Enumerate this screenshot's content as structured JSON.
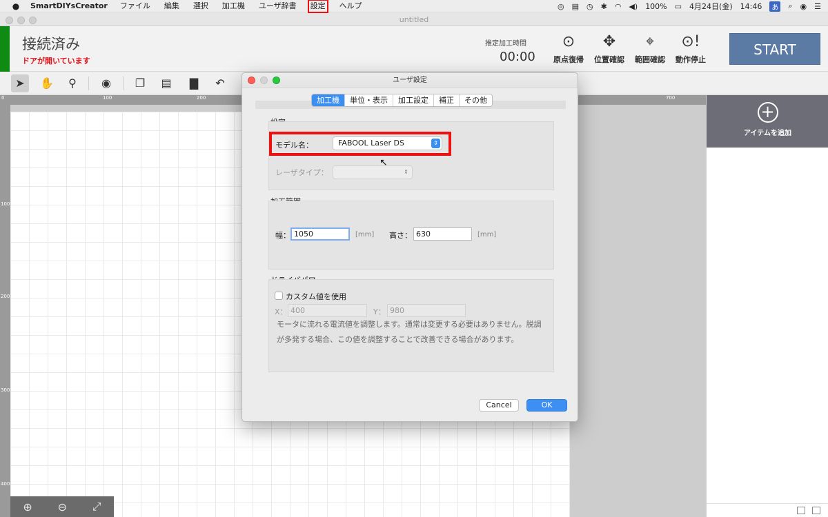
{
  "menubar": {
    "apple": "",
    "app_name": "SmartDIYsCreator",
    "items": [
      "ファイル",
      "編集",
      "選択",
      "加工機",
      "ユーザ辞書",
      "設定",
      "ヘルプ"
    ],
    "battery": "100%",
    "datetime": "4月24日(金)",
    "clock": "14:46",
    "ime": "あ"
  },
  "window": {
    "title": "untitled"
  },
  "status": {
    "connection": "接続済み",
    "door_warning": "ドアが開いています",
    "time_label": "推定加工時間",
    "time_value": "00:00",
    "tools": [
      "原点復帰",
      "位置確認",
      "範囲確認",
      "動作停止"
    ],
    "start": "START"
  },
  "ruler": {
    "top": [
      "0",
      "100",
      "200",
      "700"
    ],
    "left": [
      "100",
      "200",
      "300",
      "400"
    ]
  },
  "right_panel": {
    "add_item": "アイテムを追加"
  },
  "dialog": {
    "title": "ユーザ設定",
    "tabs": [
      "加工機",
      "単位・表示",
      "加工設定",
      "補正",
      "その他"
    ],
    "settings_group": "設定",
    "model_label": "モデル名：",
    "model_value": "FABOOL Laser DS",
    "laser_type_label": "レーザタイプ：",
    "range_group": "加工範囲",
    "width_label": "幅：",
    "width_value": "1050",
    "width_unit": "[mm]",
    "height_label": "高さ：",
    "height_value": "630",
    "height_unit": "[mm]",
    "power_group": "ドライバパワー",
    "custom_label": "カスタム値を使用",
    "x_label": "X：",
    "x_value": "400",
    "y_label": "Y：",
    "y_value": "980",
    "desc_line1": "モータに流れる電流値を調整します。通常は変更する必要はありません。脱調",
    "desc_line2": "が多発する場合、この値を調整することで改善できる場合があります。",
    "cancel": "Cancel",
    "ok": "OK"
  },
  "colors": {
    "connected": "#0f8a12",
    "warning": "#e1141b",
    "start": "#5b7aa4",
    "accent": "#3b8ff0",
    "highlight": "#ee1111"
  }
}
